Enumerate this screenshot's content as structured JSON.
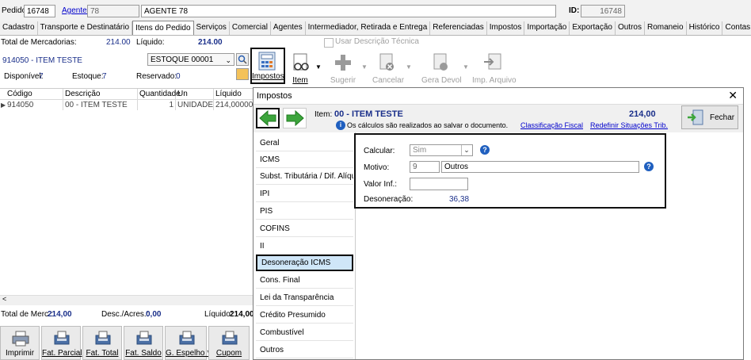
{
  "header": {
    "pedido_label": "Pedido:",
    "pedido_value": "16748",
    "agente_label": "Agente:",
    "agente_code": "78",
    "agente_name": "AGENTE 78",
    "id_label": "ID:",
    "id_value": "16748"
  },
  "tabs": [
    "Cadastro",
    "Transporte e Destinatário",
    "Itens do Pedido",
    "Serviços",
    "Comercial",
    "Agentes",
    "Intermediador, Retirada e Entrega",
    "Referenciadas",
    "Impostos",
    "Importação",
    "Exportação",
    "Outros",
    "Romaneio",
    "Histórico",
    "Contas"
  ],
  "active_tab": "Itens do Pedido",
  "summary": {
    "total_merc_label": "Total de Mercadorias:",
    "total_merc_value": "214.00",
    "liquido_label": "Líquido:",
    "liquido_value": "214.00",
    "usar_desc_label": "Usar Descrição Técnica"
  },
  "item_panel": {
    "item_title": "914050 - ITEM TESTE",
    "estoque_select": "ESTOQUE 00001",
    "disponivel_label": "Disponível:",
    "disponivel_value": "7",
    "estoque_label": "Estoque:",
    "estoque_value": "7",
    "reservado_label": "Reservado:",
    "reservado_value": "0"
  },
  "toolbar": {
    "impostos": "Impostos",
    "item": "Item",
    "sugerir": "Sugerir",
    "cancelar": "Cancelar",
    "gera_devol": "Gera Devol",
    "imp_arquivo": "Imp. Arquivo"
  },
  "grid": {
    "columns": [
      "Código",
      "Descrição",
      "Quantidade",
      "Un",
      "Líquido"
    ],
    "rows": [
      {
        "codigo": "914050",
        "descricao": "00 - ITEM TESTE",
        "quantidade": "1",
        "un": "UNIDADE",
        "liquido": "214,000000"
      }
    ]
  },
  "footer": {
    "total_merc_label": "Total de Merc.:",
    "total_merc_value": "214,00",
    "desc_label": "Desc./Acres.:",
    "desc_value": "0,00",
    "liquido_label": "Líquido:",
    "liquido_value": "214,00"
  },
  "bottom_buttons": [
    "Imprimir",
    "Fat. Parcial",
    "Fat. Total",
    "Fat. Saldo",
    "G. Espelho *",
    "Cupom"
  ],
  "dialog": {
    "title": "Impostos",
    "item_label": "Item:",
    "item_value": "00 - ITEM TESTE",
    "total": "214,00",
    "info_text": "Os cálculos são realizados ao salvar o documento.",
    "classificacao_link": "Classificação Fiscal",
    "redefinir_link": "Redefinir Situações Trib.",
    "fechar": "Fechar",
    "nav_items": [
      "Geral",
      "ICMS",
      "Subst. Tributária / Dif. Alíquota",
      "IPI",
      "PIS",
      "COFINS",
      "II",
      "Desoneração ICMS",
      "Cons. Final",
      "Lei da Transparência",
      "Crédito Presumido",
      "Combustível",
      "Outros"
    ],
    "selected_nav": "Desoneração ICMS",
    "form": {
      "calcular_label": "Calcular:",
      "calcular_value": "Sim",
      "motivo_label": "Motivo:",
      "motivo_code": "9",
      "motivo_desc": "Outros",
      "valor_inf_label": "Valor Inf.:",
      "valor_inf_value": "",
      "desoneracao_label": "Desoneração:",
      "desoneracao_value": "36,38"
    }
  },
  "colors": {
    "accent_blue": "#1a2f8a",
    "link_blue": "#0000cc",
    "nav_selected": "#cfe6f8",
    "arrow_green": "#3ca53c"
  }
}
